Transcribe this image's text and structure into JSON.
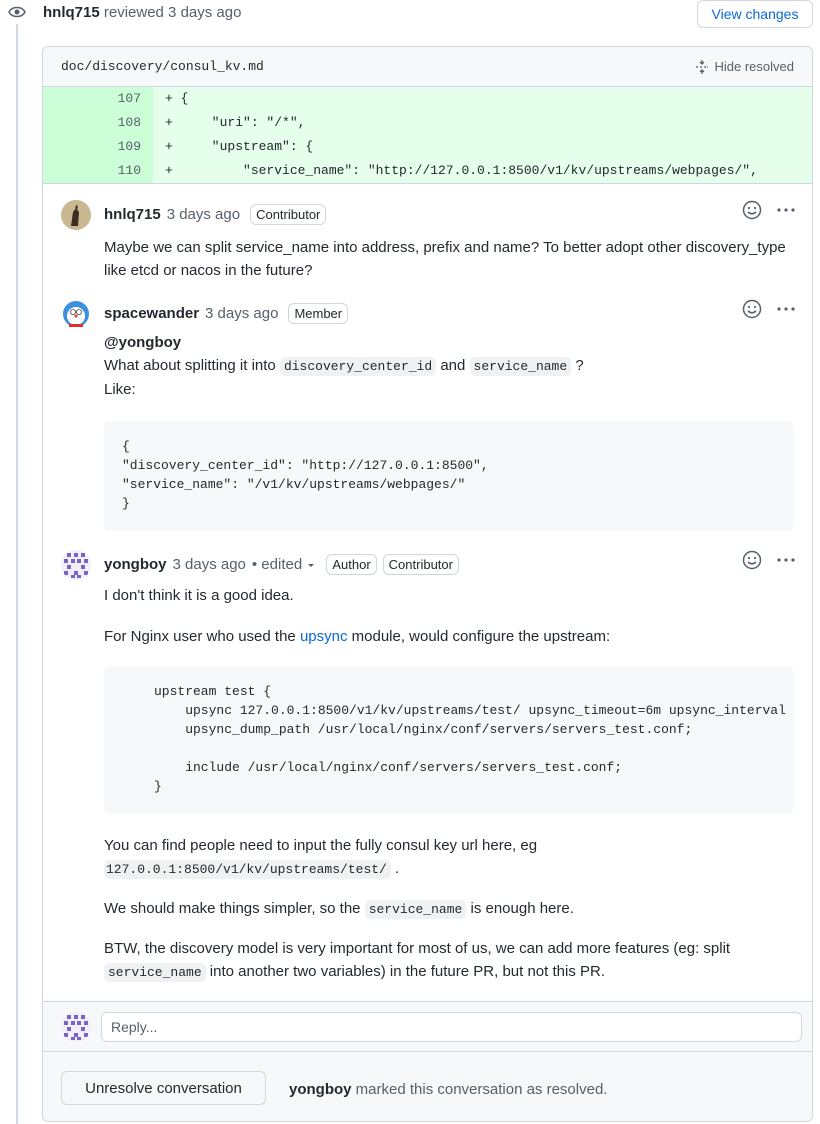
{
  "review": {
    "author": "hnlq715",
    "action": "reviewed 3 days ago",
    "view_changes": "View changes"
  },
  "file": {
    "path": "doc/discovery/consul_kv.md",
    "hide_resolved": "Hide resolved",
    "diff": [
      {
        "num": "107",
        "code": "+ {"
      },
      {
        "num": "108",
        "code": "+     \"uri\": \"/*\","
      },
      {
        "num": "109",
        "code": "+     \"upstream\": {"
      },
      {
        "num": "110",
        "code": "+         \"service_name\": \"http://127.0.0.1:8500/v1/kv/upstreams/webpages/\","
      }
    ]
  },
  "comments": {
    "c1": {
      "author": "hnlq715",
      "time": "3 days ago",
      "badge": "Contributor",
      "body": "Maybe we can split service_name into address, prefix and name? To better adopt other discovery_type like etcd or nacos in the future?"
    },
    "c2": {
      "author": "spacewander",
      "time": "3 days ago",
      "badge": "Member",
      "mention": "@yongboy",
      "line1_pre": "What about splitting it into ",
      "code1": "discovery_center_id",
      "and": " and ",
      "code2": "service_name",
      "q": " ?",
      "like": "Like:",
      "block": "{\n\"discovery_center_id\": \"http://127.0.0.1:8500\",\n\"service_name\": \"/v1/kv/upstreams/webpages/\"\n}"
    },
    "c3": {
      "author": "yongboy",
      "time": "3 days ago",
      "edited": "• edited",
      "badge1": "Author",
      "badge2": "Contributor",
      "p1": "I don't think it is a good idea.",
      "p2_pre": "For Nginx user who used the ",
      "p2_link": "upsync",
      "p2_post": " module, would configure the upstream:",
      "block": "upstream test {\n    upsync 127.0.0.1:8500/v1/kv/upstreams/test/ upsync_timeout=6m upsync_interval\n    upsync_dump_path /usr/local/nginx/conf/servers/servers_test.conf;\n\n    include /usr/local/nginx/conf/servers/servers_test.conf;\n}",
      "p3": "You can find people need to input the fully consul key url here, eg",
      "p3_code": "127.0.0.1:8500/v1/kv/upstreams/test/",
      "p3_end": " .",
      "p4_pre": "We should make things simpler, so the ",
      "p4_code": "service_name",
      "p4_post": " is enough here.",
      "p5_pre": "BTW, the discovery model is very important for most of us, we can add more features (eg: split",
      "p5_code": "service_name",
      "p5_post": " into another two variables) in the future PR, but not this PR."
    }
  },
  "reply": {
    "placeholder": "Reply..."
  },
  "footer": {
    "unresolve": "Unresolve conversation",
    "resolver": "yongboy",
    "resolved_text": " marked this conversation as resolved."
  },
  "colors": {
    "link": "#0969da",
    "diff_bg": "#e6ffec",
    "diff_num_bg": "#ccffd8",
    "border": "#d0d7de"
  },
  "icons": [
    "eye-icon",
    "unfold-icon",
    "smiley-icon",
    "kebab-icon"
  ]
}
